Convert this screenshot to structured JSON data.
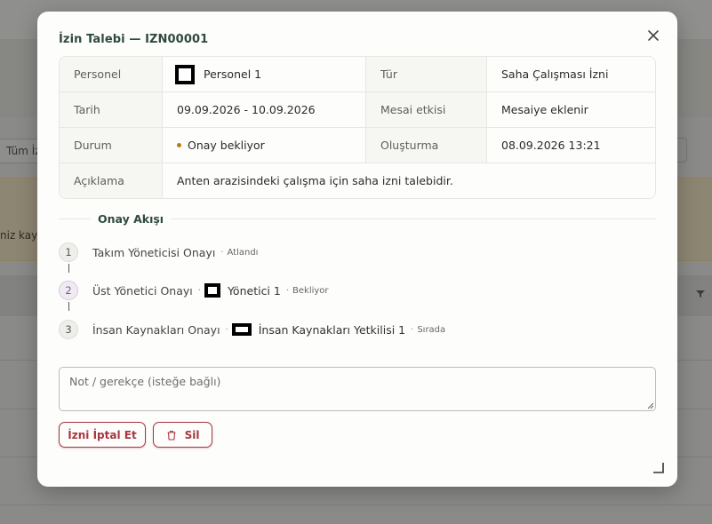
{
  "background": {
    "chip_label": "Tüm İzinler",
    "banner_text": "niz kayıt",
    "filter_icon": "filter-icon"
  },
  "modal": {
    "title": "İzin Talebi — IZN00001",
    "close_icon": "close-icon",
    "details": {
      "personel_label": "Personel",
      "personel_value": "Personel 1",
      "tur_label": "Tür",
      "tur_value": "Saha Çalışması İzni",
      "tarih_label": "Tarih",
      "tarih_value": "09.09.2026 - 10.09.2026",
      "mesai_label": "Mesai etkisi",
      "mesai_value": "Mesaiye eklenir",
      "durum_label": "Durum",
      "durum_value": "Onay bekliyor",
      "olusturma_label": "Oluşturma",
      "olusturma_value": "08.09.2026 13:21",
      "aciklama_label": "Açıklama",
      "aciklama_value": "Anten arazisindeki çalışma için saha izni talebidir."
    },
    "approval": {
      "title": "Onay Akışı",
      "steps": [
        {
          "num": "1",
          "label": "Takım Yöneticisi Onayı",
          "separator": "·",
          "person": "",
          "status": "Atlandı"
        },
        {
          "num": "2",
          "label": "Üst Yönetici Onayı",
          "separator": "·",
          "person": "Yönetici 1",
          "status": "Bekliyor"
        },
        {
          "num": "3",
          "label": "İnsan Kaynakları Onayı",
          "separator": "·",
          "person": "İnsan Kaynakları Yetkilisi 1",
          "status": "Sırada"
        }
      ]
    },
    "note": {
      "placeholder": "Not / gerekçe (isteğe bağlı)",
      "value": ""
    },
    "buttons": {
      "cancel_label": "İzni İptal Et",
      "delete_label": "Sil"
    },
    "colors": {
      "accent_green": "#2e4a3f",
      "danger": "#a8353f",
      "pending_dot": "#b87d12"
    }
  }
}
